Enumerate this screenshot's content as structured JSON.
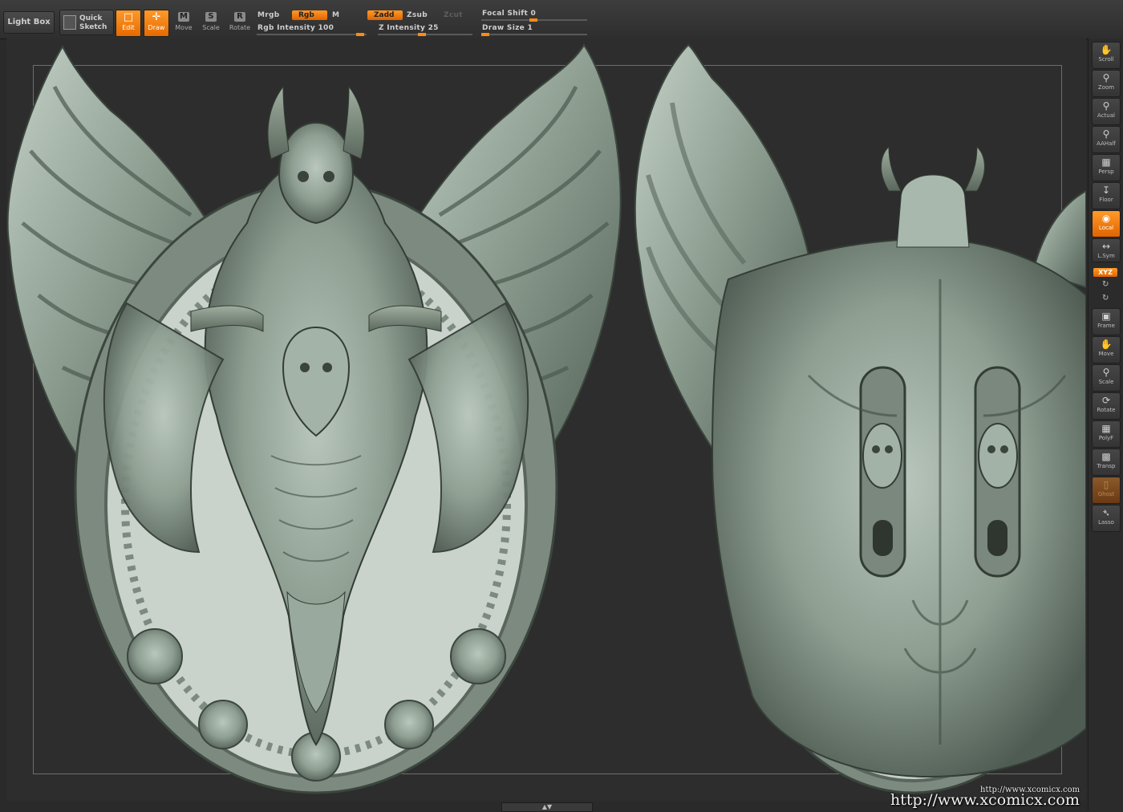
{
  "toolbar": {
    "light_box": "Light Box",
    "quick_sketch_line1": "Quick",
    "quick_sketch_line2": "Sketch",
    "edit": "Edit",
    "draw": "Draw",
    "move": "Move",
    "scale": "Scale",
    "rotate": "Rotate",
    "mrgb": "Mrgb",
    "rgb": "Rgb",
    "m": "M",
    "zadd": "Zadd",
    "zsub": "Zsub",
    "zcut": "Zcut",
    "rgb_intensity": "Rgb  Intensity 100",
    "z_intensity": "Z  Intensity 25",
    "focal_shift": "Focal Shift 0",
    "draw_size": "Draw Size 1",
    "rgb_intensity_value": 100,
    "z_intensity_value": 25,
    "focal_shift_value": 0,
    "draw_size_value": 1,
    "accent_color": "#ff8a14"
  },
  "shelf": {
    "scroll": "Scroll",
    "zoom": "Zoom",
    "actual": "Actual",
    "aahalf": "AAHalf",
    "persp": "Persp",
    "floor": "Floor",
    "local": "Local",
    "lsym": "L.Sym",
    "xyz": "XYZ",
    "frame": "Frame",
    "move": "Move",
    "scale": "Scale",
    "rotate": "Rotate",
    "polyf": "PolyF",
    "transp": "Transp",
    "ghost": "Ghost",
    "lasso": "Lasso"
  },
  "viewport": {
    "background_color": "#2d2d2d",
    "model_color": "#8e9e91"
  },
  "watermark": {
    "small": "http://www.xcomicx.com",
    "large": "http://www.xcomicx.com"
  }
}
